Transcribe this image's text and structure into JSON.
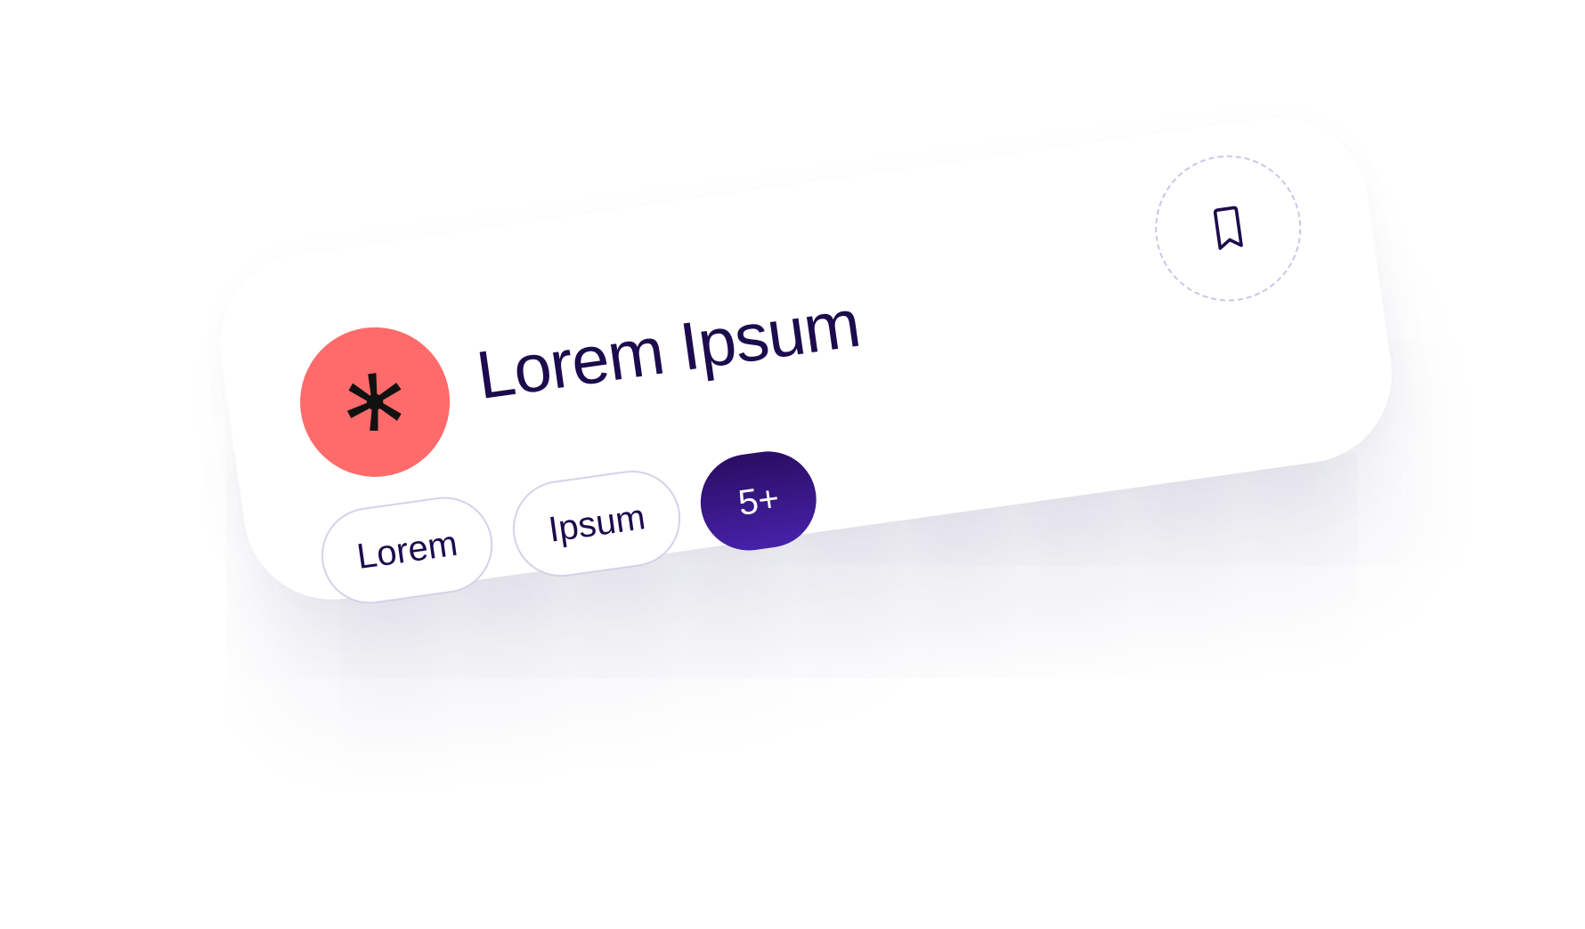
{
  "card": {
    "title": "Lorem Ipsum",
    "avatar_icon": "asterisk-burst-icon",
    "bookmark_icon": "bookmark-icon",
    "tags": [
      {
        "label": "Lorem"
      },
      {
        "label": "Ipsum"
      }
    ],
    "more_label": "5+"
  },
  "colors": {
    "avatar_bg": "#ff6a6a",
    "title_text": "#1c0b4d",
    "more_badge_top": "#2a0d63",
    "more_badge_bottom": "#4622a8",
    "tag_border": "#d6d1ea",
    "bookmark_border": "#cbc5e6"
  }
}
